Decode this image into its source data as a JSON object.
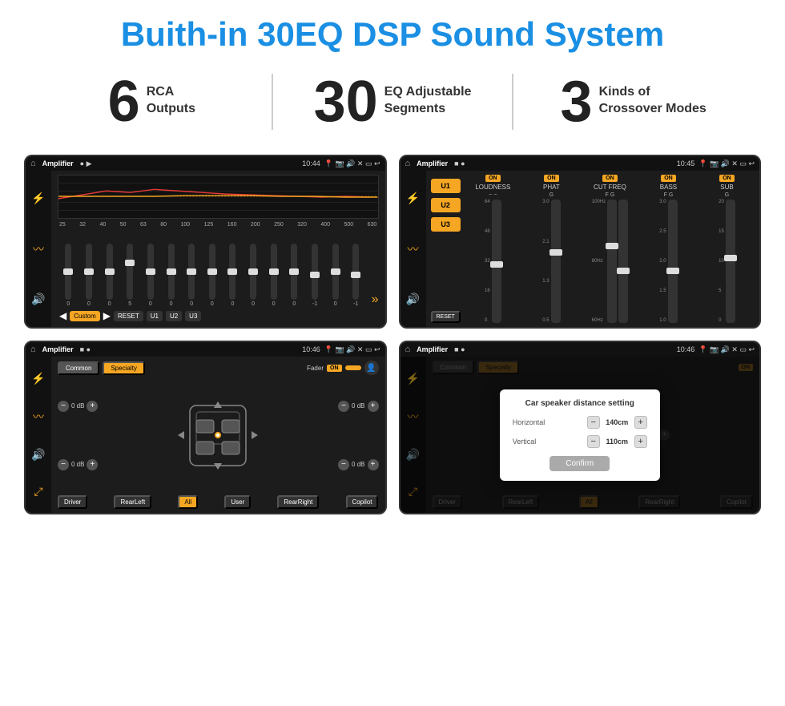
{
  "header": {
    "title": "Buith-in 30EQ DSP Sound System"
  },
  "stats": [
    {
      "number": "6",
      "label": "RCA\nOutputs"
    },
    {
      "number": "30",
      "label": "EQ Adjustable\nSegments"
    },
    {
      "number": "3",
      "label": "Kinds of\nCrossover Modes"
    }
  ],
  "screens": [
    {
      "id": "eq-screen",
      "status": {
        "app": "Amplifier",
        "time": "10:44"
      },
      "type": "eq",
      "freqs": [
        "25",
        "32",
        "40",
        "50",
        "63",
        "80",
        "100",
        "125",
        "160",
        "200",
        "250",
        "320",
        "400",
        "500",
        "630"
      ],
      "values": [
        "0",
        "0",
        "0",
        "5",
        "0",
        "0",
        "0",
        "0",
        "0",
        "0",
        "0",
        "0",
        "-1",
        "0",
        "-1"
      ],
      "buttons": [
        "Custom",
        "RESET",
        "U1",
        "U2",
        "U3"
      ]
    },
    {
      "id": "crossover-screen",
      "status": {
        "app": "Amplifier",
        "time": "10:45"
      },
      "type": "crossover",
      "u_options": [
        "U1",
        "U2",
        "U3"
      ],
      "channels": [
        "LOUDNESS",
        "PHAT",
        "CUT FREQ",
        "BASS",
        "SUB"
      ],
      "channel_states": [
        "ON",
        "ON",
        "ON",
        "ON",
        "ON"
      ]
    },
    {
      "id": "speaker-screen",
      "status": {
        "app": "Amplifier",
        "time": "10:46"
      },
      "type": "speaker",
      "tabs": [
        "Common",
        "Specialty"
      ],
      "fader_label": "Fader",
      "fader_state": "ON",
      "db_values": [
        "0 dB",
        "0 dB",
        "0 dB",
        "0 dB"
      ],
      "bottom_labels": [
        "Driver",
        "RearLeft",
        "All",
        "User",
        "RearRight",
        "Copilot"
      ]
    },
    {
      "id": "dialog-screen",
      "status": {
        "app": "Amplifier",
        "time": "10:46"
      },
      "type": "speaker-dialog",
      "tabs": [
        "Common",
        "Specialty"
      ],
      "dialog": {
        "title": "Car speaker distance setting",
        "fields": [
          {
            "label": "Horizontal",
            "value": "140cm"
          },
          {
            "label": "Vertical",
            "value": "110cm"
          }
        ],
        "confirm_label": "Confirm"
      }
    }
  ]
}
